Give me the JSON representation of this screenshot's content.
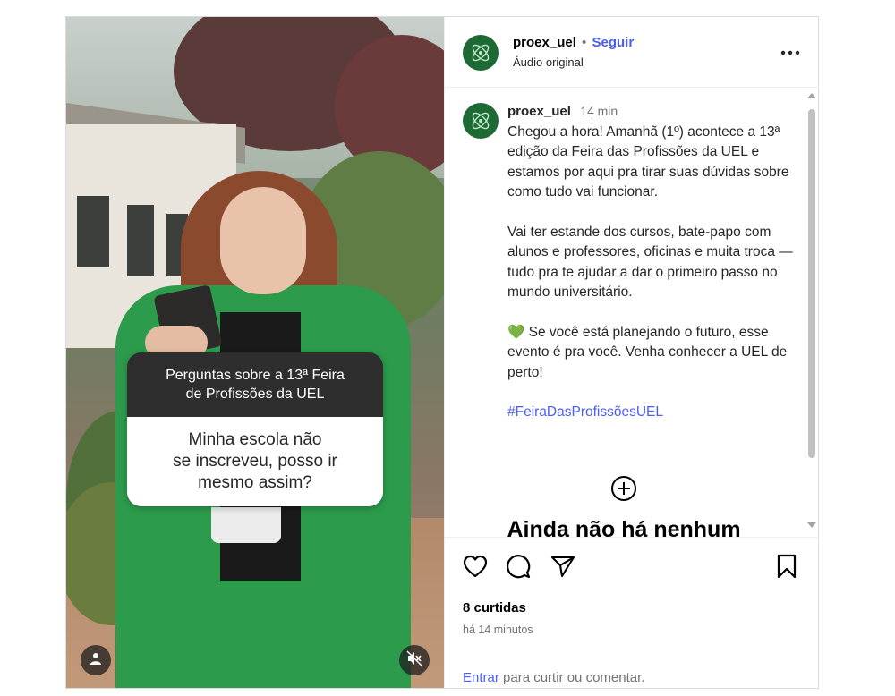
{
  "header": {
    "username": "proex_uel",
    "separator": "•",
    "follow_label": "Seguir",
    "audio_label": "Áudio original",
    "more_icon": "more-horizontal-icon"
  },
  "media": {
    "question_title": "Perguntas sobre a 13ª Feira\nde Profissões da UEL",
    "question_text": "Minha escola não\nse inscreveu, posso ir\nmesmo assim?",
    "user_icon": "person-icon",
    "mute_icon": "speaker-muted-icon"
  },
  "caption": {
    "username": "proex_uel",
    "timestamp": "14 min",
    "paragraph1": "Chegou a hora! Amanhã (1º) acontece a 13ª edição da Feira das Profissões da UEL e estamos por aqui pra tirar suas dúvidas sobre como tudo vai funcionar.",
    "paragraph2": "Vai ter estande dos cursos, bate-papo com alunos e professores, oficinas e muita troca — tudo pra te ajudar a dar o primeiro passo no mundo universitário.",
    "heart_emoji": "💚",
    "paragraph3": "Se você está planejando o futuro, esse evento é pra você. Venha conhecer a UEL de perto!",
    "hashtag": "#FeiraDasProfissõesUEL",
    "add_icon": "plus-circle-icon",
    "no_comments_title": "Ainda não há nenhum"
  },
  "actions": {
    "like_icon": "heart-icon",
    "comment_icon": "comment-icon",
    "share_icon": "send-icon",
    "save_icon": "bookmark-icon",
    "likes_text": "8 curtidas",
    "time_ago": "há 14 minutos",
    "login_link": "Entrar",
    "login_rest": " para curtir ou comentar."
  },
  "colors": {
    "accent": "#4a5df9",
    "brand_green": "#1d6a34",
    "vest_green": "#2c9b4c"
  }
}
